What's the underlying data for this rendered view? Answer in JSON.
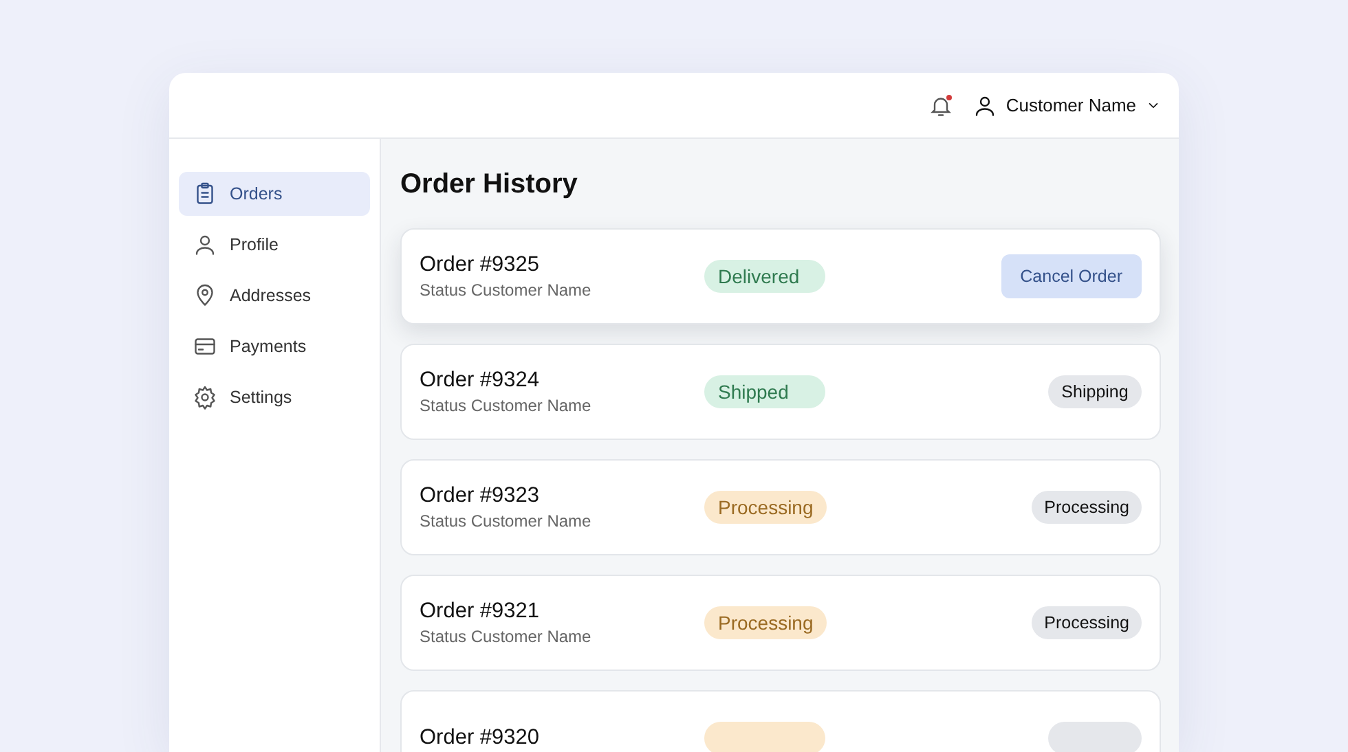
{
  "header": {
    "notification_unread": true,
    "user_name": "Customer Name"
  },
  "sidebar": {
    "items": [
      {
        "label": "Orders",
        "kind": "clipboard",
        "selected": true
      },
      {
        "label": "Profile",
        "kind": "person",
        "selected": false
      },
      {
        "label": "Addresses",
        "kind": "pin",
        "selected": false
      },
      {
        "label": "Payments",
        "kind": "card",
        "selected": false
      },
      {
        "label": "Settings",
        "kind": "gear",
        "selected": false
      }
    ]
  },
  "main": {
    "title": "Order History",
    "orders": [
      {
        "title": "Order #9325",
        "subtitle": "Status Customer Name",
        "highlighted": true,
        "status": {
          "label": "Delivered",
          "kind": "success"
        },
        "action": {
          "label": "Cancel Order",
          "kind": "primary"
        }
      },
      {
        "title": "Order #9324",
        "subtitle": "Status Customer Name",
        "highlighted": false,
        "status": {
          "label": "Shipped",
          "kind": "success"
        },
        "action": {
          "label": "Shipping",
          "kind": "neutral"
        }
      },
      {
        "title": "Order #9323",
        "subtitle": "Status Customer Name",
        "highlighted": false,
        "status": {
          "label": "Processing",
          "kind": "warning"
        },
        "action": {
          "label": "Processing",
          "kind": "neutral"
        }
      },
      {
        "title": "Order #9321",
        "subtitle": "Status Customer Name",
        "highlighted": false,
        "status": {
          "label": "Processing",
          "kind": "warning"
        },
        "action": {
          "label": "Processing",
          "kind": "neutral"
        }
      },
      {
        "title": "Order #9320",
        "highlighted": false,
        "status": {
          "kind": "warning"
        },
        "action": {
          "kind": "neutral"
        }
      }
    ]
  }
}
